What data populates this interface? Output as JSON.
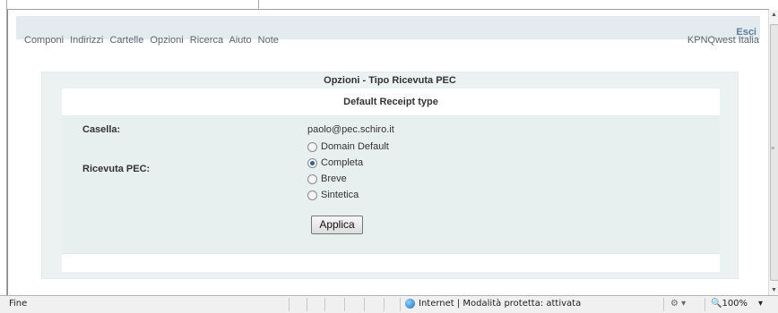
{
  "header": {
    "logout_label": "Esci"
  },
  "nav": {
    "links": [
      "Componi",
      "Indirizzi",
      "Cartelle",
      "Opzioni",
      "Ricerca",
      "Aiuto",
      "Note"
    ],
    "org": "KPNQwest Italia"
  },
  "page": {
    "title": "Opzioni - Tipo Ricevuta PEC",
    "section_title": "Default Receipt type"
  },
  "form": {
    "mailbox_label": "Casella:",
    "mailbox_value": "paolo@pec.schiro.it",
    "receipt_label": "Ricevuta PEC:",
    "options": [
      {
        "label": "Domain Default",
        "selected": false
      },
      {
        "label": "Completa",
        "selected": true
      },
      {
        "label": "Breve",
        "selected": false
      },
      {
        "label": "Sintetica",
        "selected": false
      }
    ],
    "apply_label": "Applica"
  },
  "statusbar": {
    "left": "Fine",
    "zone": "Internet | Modalità protetta: attivata",
    "zoom": "100%"
  },
  "colors": {
    "accent": "#5b7c9d",
    "panel": "#ecf1f1",
    "form_bg": "#e8efef"
  }
}
